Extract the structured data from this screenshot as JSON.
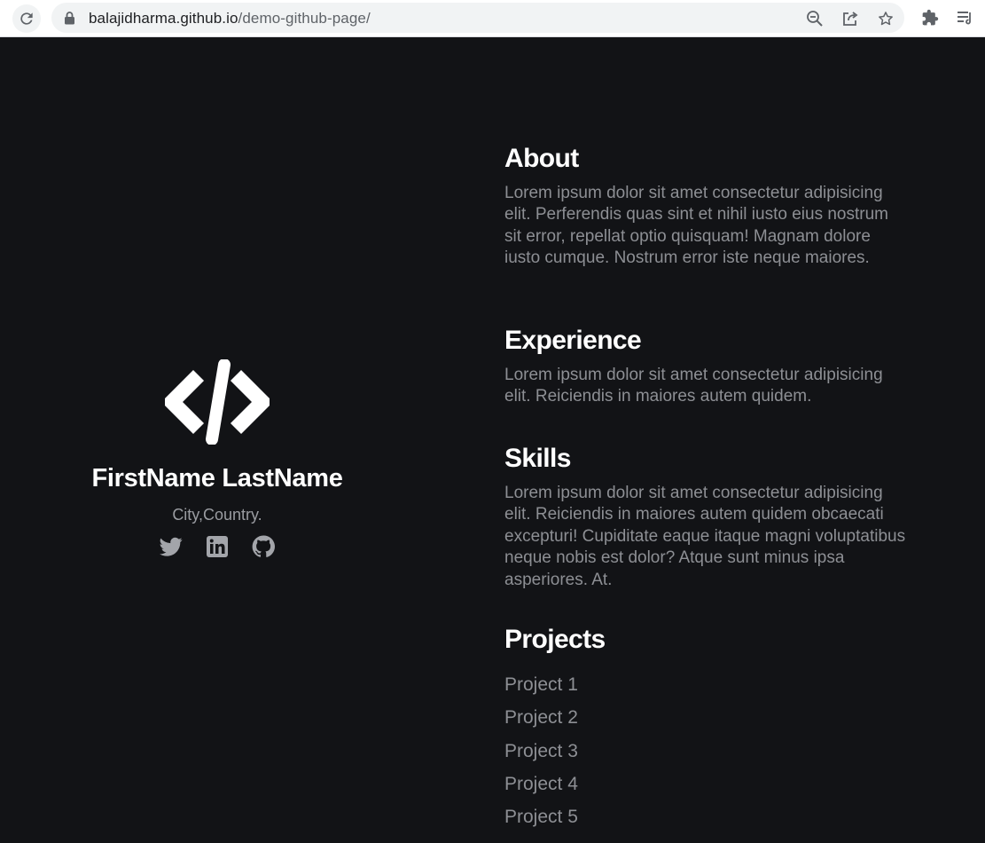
{
  "browser": {
    "url_domain": "balajidharma.github.io",
    "url_path": "/demo-github-page/",
    "icons": [
      "reload-icon",
      "lock-icon",
      "zoom-out-icon",
      "share-icon",
      "star-icon",
      "extensions-icon",
      "reading-list-icon"
    ]
  },
  "profile": {
    "logo_icon": "code-icon",
    "name": "FirstName LastName",
    "location": "City,Country.",
    "social": [
      "twitter-icon",
      "linkedin-icon",
      "github-icon"
    ]
  },
  "sections": {
    "about": {
      "title": "About",
      "text": "Lorem ipsum dolor sit amet consectetur adipisicing elit. Perferendis quas sint et nihil iusto eius nostrum sit error, repellat optio quisquam! Magnam dolore iusto cumque. Nostrum error iste neque maiores."
    },
    "experience": {
      "title": "Experience",
      "text": "Lorem ipsum dolor sit amet consectetur adipisicing elit. Reiciendis in maiores autem quidem."
    },
    "skills": {
      "title": "Skills",
      "text": "Lorem ipsum dolor sit amet consectetur adipisicing elit. Reiciendis in maiores autem quidem obcaecati excepturi! Cupiditate eaque itaque magni voluptatibus neque nobis est dolor? Atque sunt minus ipsa asperiores. At."
    },
    "projects": {
      "title": "Projects",
      "items": [
        "Project 1",
        "Project 2",
        "Project 3",
        "Project 4",
        "Project 5"
      ]
    }
  },
  "colors": {
    "background": "#121316",
    "heading": "#ffffff",
    "body_text": "#8d8f94"
  }
}
